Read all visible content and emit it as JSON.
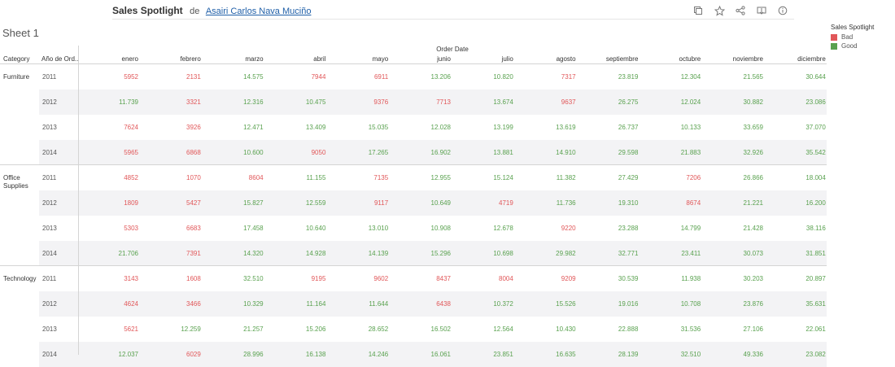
{
  "header": {
    "title": "Sales Spotlight",
    "by": "de",
    "author": "Asairi Carlos Nava Muciño"
  },
  "toolbar": {
    "icons": [
      "copy-icon",
      "star-icon",
      "share-icon",
      "download-icon",
      "info-icon"
    ]
  },
  "sheet_title": "Sheet 1",
  "column_group": "Order Date",
  "row_headers": [
    "Category",
    "Año de Ord.."
  ],
  "months": [
    "enero",
    "febrero",
    "marzo",
    "abril",
    "mayo",
    "junio",
    "julio",
    "agosto",
    "septiembre",
    "octubre",
    "noviembre",
    "diciembre"
  ],
  "colors": {
    "bad": "#e15759",
    "good": "#59a14f"
  },
  "legend": {
    "title": "Sales Spotlight",
    "items": [
      {
        "label": "Bad",
        "color": "#e15759"
      },
      {
        "label": "Good",
        "color": "#59a14f"
      }
    ]
  },
  "categories": [
    {
      "name": "Furniture",
      "rows": [
        {
          "year": "2011",
          "values": [
            "5952",
            "2131",
            "14.575",
            "7944",
            "6911",
            "13.206",
            "10.820",
            "7317",
            "23.819",
            "12.304",
            "21.565",
            "30.644"
          ],
          "flags": [
            "b",
            "b",
            "g",
            "b",
            "b",
            "g",
            "g",
            "b",
            "g",
            "g",
            "g",
            "g"
          ]
        },
        {
          "year": "2012",
          "values": [
            "11.739",
            "3321",
            "12.316",
            "10.475",
            "9376",
            "7713",
            "13.674",
            "9637",
            "26.275",
            "12.024",
            "30.882",
            "23.086"
          ],
          "flags": [
            "g",
            "b",
            "g",
            "g",
            "b",
            "b",
            "g",
            "b",
            "g",
            "g",
            "g",
            "g"
          ]
        },
        {
          "year": "2013",
          "values": [
            "7624",
            "3926",
            "12.471",
            "13.409",
            "15.035",
            "12.028",
            "13.199",
            "13.619",
            "26.737",
            "10.133",
            "33.659",
            "37.070"
          ],
          "flags": [
            "b",
            "b",
            "g",
            "g",
            "g",
            "g",
            "g",
            "g",
            "g",
            "g",
            "g",
            "g"
          ]
        },
        {
          "year": "2014",
          "values": [
            "5965",
            "6868",
            "10.600",
            "9050",
            "17.265",
            "16.902",
            "13.881",
            "14.910",
            "29.598",
            "21.883",
            "32.926",
            "35.542"
          ],
          "flags": [
            "b",
            "b",
            "g",
            "b",
            "g",
            "g",
            "g",
            "g",
            "g",
            "g",
            "g",
            "g"
          ]
        }
      ]
    },
    {
      "name": "Office Supplies",
      "rows": [
        {
          "year": "2011",
          "values": [
            "4852",
            "1070",
            "8604",
            "11.155",
            "7135",
            "12.955",
            "15.124",
            "11.382",
            "27.429",
            "7206",
            "26.866",
            "18.004"
          ],
          "flags": [
            "b",
            "b",
            "b",
            "g",
            "b",
            "g",
            "g",
            "g",
            "g",
            "b",
            "g",
            "g"
          ]
        },
        {
          "year": "2012",
          "values": [
            "1809",
            "5427",
            "15.827",
            "12.559",
            "9117",
            "10.649",
            "4719",
            "11.736",
            "19.310",
            "8674",
            "21.221",
            "16.200"
          ],
          "flags": [
            "b",
            "b",
            "g",
            "g",
            "b",
            "g",
            "b",
            "g",
            "g",
            "b",
            "g",
            "g"
          ]
        },
        {
          "year": "2013",
          "values": [
            "5303",
            "6683",
            "17.458",
            "10.640",
            "13.010",
            "10.908",
            "12.678",
            "9220",
            "23.288",
            "14.799",
            "21.428",
            "38.116"
          ],
          "flags": [
            "b",
            "b",
            "g",
            "g",
            "g",
            "g",
            "g",
            "b",
            "g",
            "g",
            "g",
            "g"
          ]
        },
        {
          "year": "2014",
          "values": [
            "21.706",
            "7391",
            "14.320",
            "14.928",
            "14.139",
            "15.296",
            "10.698",
            "29.982",
            "32.771",
            "23.411",
            "30.073",
            "31.851"
          ],
          "flags": [
            "g",
            "b",
            "g",
            "g",
            "g",
            "g",
            "g",
            "g",
            "g",
            "g",
            "g",
            "g"
          ]
        }
      ]
    },
    {
      "name": "Technology",
      "rows": [
        {
          "year": "2011",
          "values": [
            "3143",
            "1608",
            "32.510",
            "9195",
            "9602",
            "8437",
            "8004",
            "9209",
            "30.539",
            "11.938",
            "30.203",
            "20.897"
          ],
          "flags": [
            "b",
            "b",
            "g",
            "b",
            "b",
            "b",
            "b",
            "b",
            "g",
            "g",
            "g",
            "g"
          ]
        },
        {
          "year": "2012",
          "values": [
            "4624",
            "3466",
            "10.329",
            "11.164",
            "11.644",
            "6438",
            "10.372",
            "15.526",
            "19.016",
            "10.708",
            "23.876",
            "35.631"
          ],
          "flags": [
            "b",
            "b",
            "g",
            "g",
            "g",
            "b",
            "g",
            "g",
            "g",
            "g",
            "g",
            "g"
          ]
        },
        {
          "year": "2013",
          "values": [
            "5621",
            "12.259",
            "21.257",
            "15.206",
            "28.652",
            "16.502",
            "12.564",
            "10.430",
            "22.888",
            "31.536",
            "27.106",
            "22.061"
          ],
          "flags": [
            "b",
            "g",
            "g",
            "g",
            "g",
            "g",
            "g",
            "g",
            "g",
            "g",
            "g",
            "g"
          ]
        },
        {
          "year": "2014",
          "values": [
            "12.037",
            "6029",
            "28.996",
            "16.138",
            "14.246",
            "16.061",
            "23.851",
            "16.635",
            "28.139",
            "32.510",
            "49.336",
            "23.082"
          ],
          "flags": [
            "g",
            "b",
            "g",
            "g",
            "g",
            "g",
            "g",
            "g",
            "g",
            "g",
            "g",
            "g"
          ]
        }
      ]
    }
  ]
}
